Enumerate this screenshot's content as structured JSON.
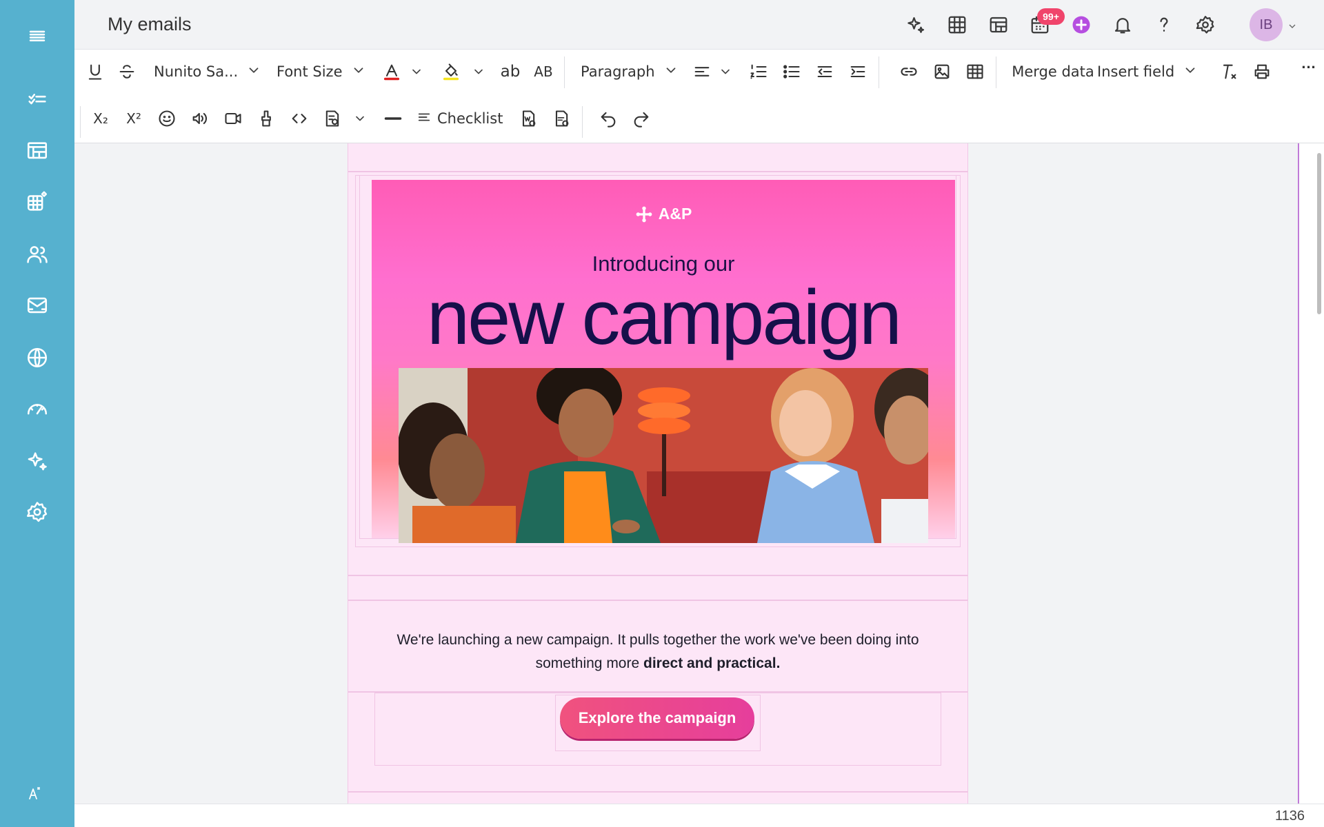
{
  "header": {
    "title": "My emails",
    "notification_badge": "99+",
    "avatar_initials": "IB",
    "icons": [
      "ai-sparkle-icon",
      "grid-icon",
      "dashboard-icon",
      "calendar-icon",
      "add-icon",
      "bell-icon",
      "help-icon",
      "settings-icon"
    ]
  },
  "sidebar": {
    "items": [
      "menu-icon",
      "tasks-icon",
      "dashboard-icon",
      "data-grid-icon",
      "contacts-icon",
      "email-icon",
      "globe-icon",
      "speedometer-icon",
      "ai-sparkle-icon",
      "settings-icon",
      "accessibility-icon"
    ]
  },
  "toolbar": {
    "font_family": "Nunito Sa...",
    "font_size": "Font Size",
    "paragraph": "Paragraph",
    "merge_data": "Merge data",
    "insert_field": "Insert field",
    "checklist": "Checklist",
    "lower_ab": "ab",
    "upper_ab": "AB",
    "subscript": "X₂",
    "superscript": "X²",
    "more": "...",
    "text_color": "#e02020",
    "highlight_color": "#f5e51e"
  },
  "email": {
    "brand": "A&P",
    "intro": "Introducing our",
    "headline": "new campaign",
    "body_part1": "We're launching a new campaign. It pulls together the work we've been doing into something more ",
    "body_bold": "direct and practical.",
    "cta_label": "Explore the campaign",
    "colors": {
      "hero_top": "#ff5cb6",
      "headline": "#16104a",
      "cta": "#f0527e",
      "canvas_bg": "#fde6f7"
    }
  },
  "status": {
    "count": "1136"
  }
}
